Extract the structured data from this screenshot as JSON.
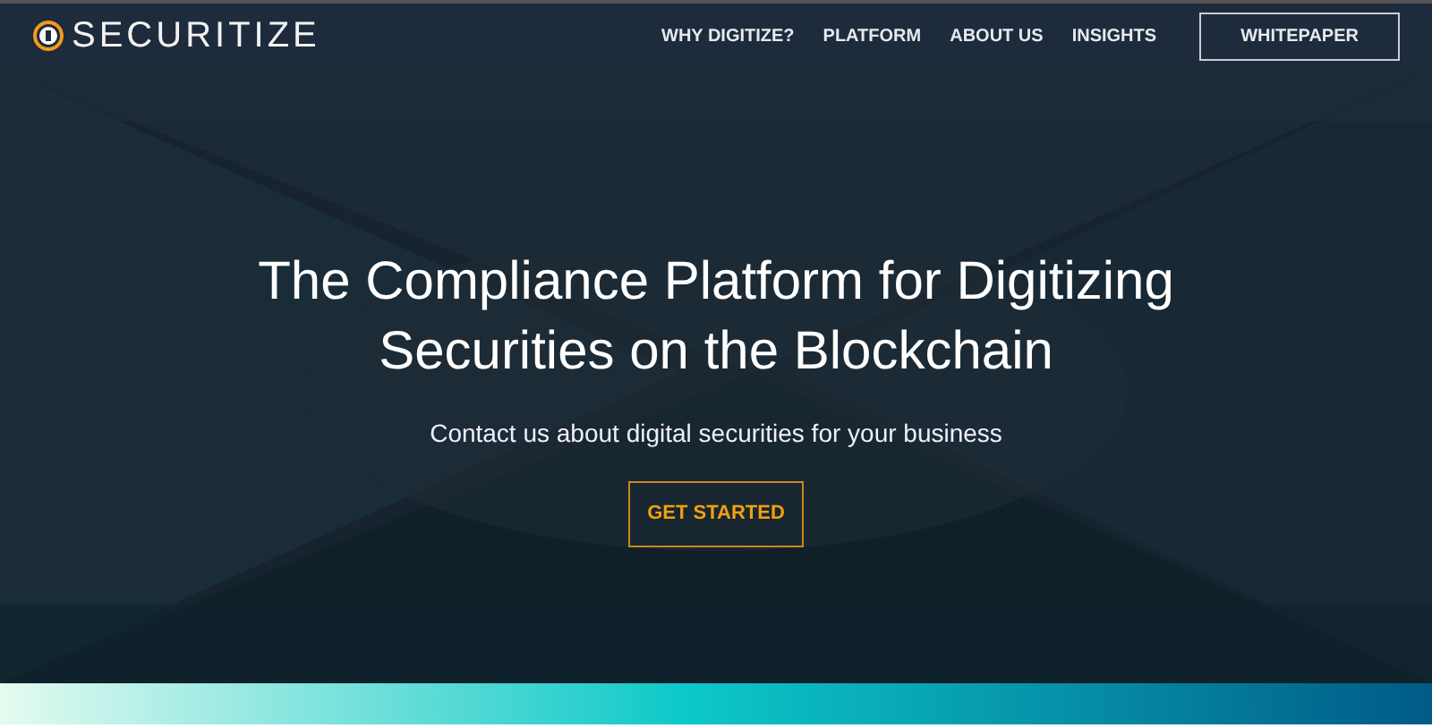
{
  "navbar": {
    "brand": "SECURITIZE",
    "links": [
      {
        "label": "WHY DIGITIZE?",
        "kind": "link"
      },
      {
        "label": "PLATFORM",
        "kind": "link"
      },
      {
        "label": "ABOUT US",
        "kind": "link"
      },
      {
        "label": "INSIGHTS",
        "kind": "link"
      },
      {
        "label": "WHITEPAPER",
        "kind": "outline"
      }
    ]
  },
  "hero": {
    "kind": "picture",
    "headline": "The Compliance Platform for Digitizing Securities on the Blockchain",
    "subtitle": "Contact us about digital securities for your business",
    "button": "GET STARTED"
  }
}
